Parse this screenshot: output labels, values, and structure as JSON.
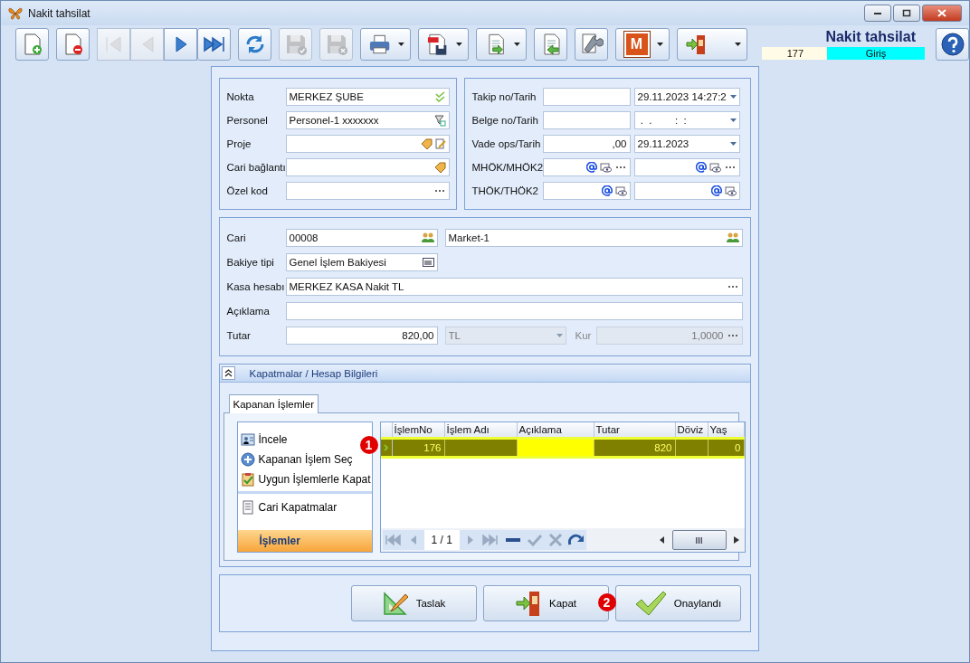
{
  "window": {
    "title": "Nakit tahsilat"
  },
  "toolbar": [
    {
      "kind": "new",
      "disabled": false,
      "dropdown": false
    },
    {
      "kind": "delete",
      "disabled": false,
      "dropdown": false
    },
    {
      "kind": "first",
      "disabled": true,
      "dropdown": false
    },
    {
      "kind": "prev",
      "disabled": true,
      "dropdown": false
    },
    {
      "kind": "next",
      "disabled": false,
      "dropdown": false
    },
    {
      "kind": "last",
      "disabled": false,
      "dropdown": false
    },
    {
      "kind": "refresh",
      "disabled": false,
      "dropdown": false
    },
    {
      "kind": "save-check",
      "disabled": true,
      "dropdown": false
    },
    {
      "kind": "save-x",
      "disabled": true,
      "dropdown": false
    },
    {
      "kind": "print",
      "disabled": false,
      "dropdown": true
    },
    {
      "kind": "pdf",
      "disabled": false,
      "dropdown": true
    },
    {
      "kind": "export",
      "disabled": false,
      "dropdown": true
    },
    {
      "kind": "import",
      "disabled": false,
      "dropdown": false
    },
    {
      "kind": "tools",
      "disabled": false,
      "dropdown": false
    },
    {
      "kind": "letter",
      "label": "M",
      "disabled": false,
      "dropdown": true
    },
    {
      "kind": "exit",
      "disabled": false,
      "dropdown": true
    }
  ],
  "header": {
    "title": "Nakit tahsilat",
    "number": "177",
    "status": "Giriş"
  },
  "left_fields": [
    {
      "label": "Nokta",
      "value": "MERKEZ ŞUBE",
      "kind": "check"
    },
    {
      "label": "Personel",
      "value": "Personel-1 xxxxxxx",
      "kind": "lookup"
    },
    {
      "label": "Proje",
      "kind": "tag-edit"
    },
    {
      "label": "Cari bağlantı",
      "kind": "tag"
    },
    {
      "label": "Özel kod",
      "kind": "ellipsis"
    }
  ],
  "right_fields": [
    {
      "label": "Takip no/Tarih",
      "field_1": {
        "kind": "plain"
      },
      "field_2": {
        "kind": "dropdown",
        "value": "29.11.2023 14:27:2"
      }
    },
    {
      "label": "Belge no/Tarih",
      "field_1": {
        "kind": "plain"
      },
      "field_2": {
        "kind": "dropdown",
        "value": " .  .        :  :"
      }
    },
    {
      "label": "Vade ops/Tarih",
      "field_1": {
        "kind": "number",
        "value": ",00"
      },
      "field_2": {
        "kind": "dropdown",
        "value": "29.11.2023"
      }
    },
    {
      "label": "MHÖK/MHÖK2",
      "field_1": {
        "kind": "at-eye-dots"
      },
      "field_2": {
        "kind": "at-eye-dots"
      }
    },
    {
      "label": "THÖK/THÖK2",
      "field_1": {
        "kind": "at-eye"
      },
      "field_2": {
        "kind": "at-eye"
      }
    }
  ],
  "account": {
    "cari_label": "Cari",
    "cari_code": "00008",
    "cari_name": "Market-1",
    "balance_label": "Bakiye tipi",
    "balance_value": "Genel İşlem Bakiyesi",
    "cash_label": "Kasa hesabı",
    "cash_value": "MERKEZ KASA Nakit TL",
    "note_label": "Açıklama",
    "amount_label": "Tutar",
    "amount_value": "820,00",
    "currency": "TL",
    "currency_disabled": true,
    "rate_label": "Kur",
    "rate_value": "1,0000",
    "rate_disabled": true
  },
  "closings": {
    "title": "Kapatmalar / Hesap Bilgileri",
    "expanded": true,
    "tabs": [
      {
        "label": "Kapanan İşlemler",
        "selected": true
      }
    ],
    "nav_groups": [
      {
        "items": [
          {
            "kind": "inspect",
            "label": "İncele"
          },
          {
            "kind": "add",
            "label": "Kapanan İşlem Seç"
          },
          {
            "kind": "checklist",
            "label": "Uygun İşlemlerle Kapat"
          }
        ]
      },
      {
        "items": [
          {
            "kind": "document",
            "label": "Cari Kapatmalar"
          }
        ]
      }
    ],
    "nav_footer": {
      "label": "İşlemler",
      "selected": true
    },
    "columns": [
      "İşlemNo",
      "İşlem Adı",
      "Açıklama",
      "Tutar",
      "Döviz",
      "Yaş"
    ],
    "rows": [
      {
        "selected": true,
        "cells": [
          {
            "text": "176",
            "focused": false
          },
          {
            "focused": false
          },
          {
            "focused": true
          },
          {
            "text": "820",
            "focused": false
          },
          {
            "focused": false
          },
          {
            "text": "0",
            "focused": false
          }
        ]
      }
    ],
    "pager": "1 / 1"
  },
  "buttons": [
    {
      "kind": "draft",
      "label": "Taslak"
    },
    {
      "kind": "exit",
      "label": "Kapat"
    },
    {
      "kind": "approve",
      "label": "Onaylandı"
    }
  ],
  "markers": [
    {
      "text": "1"
    },
    {
      "text": "2"
    }
  ]
}
